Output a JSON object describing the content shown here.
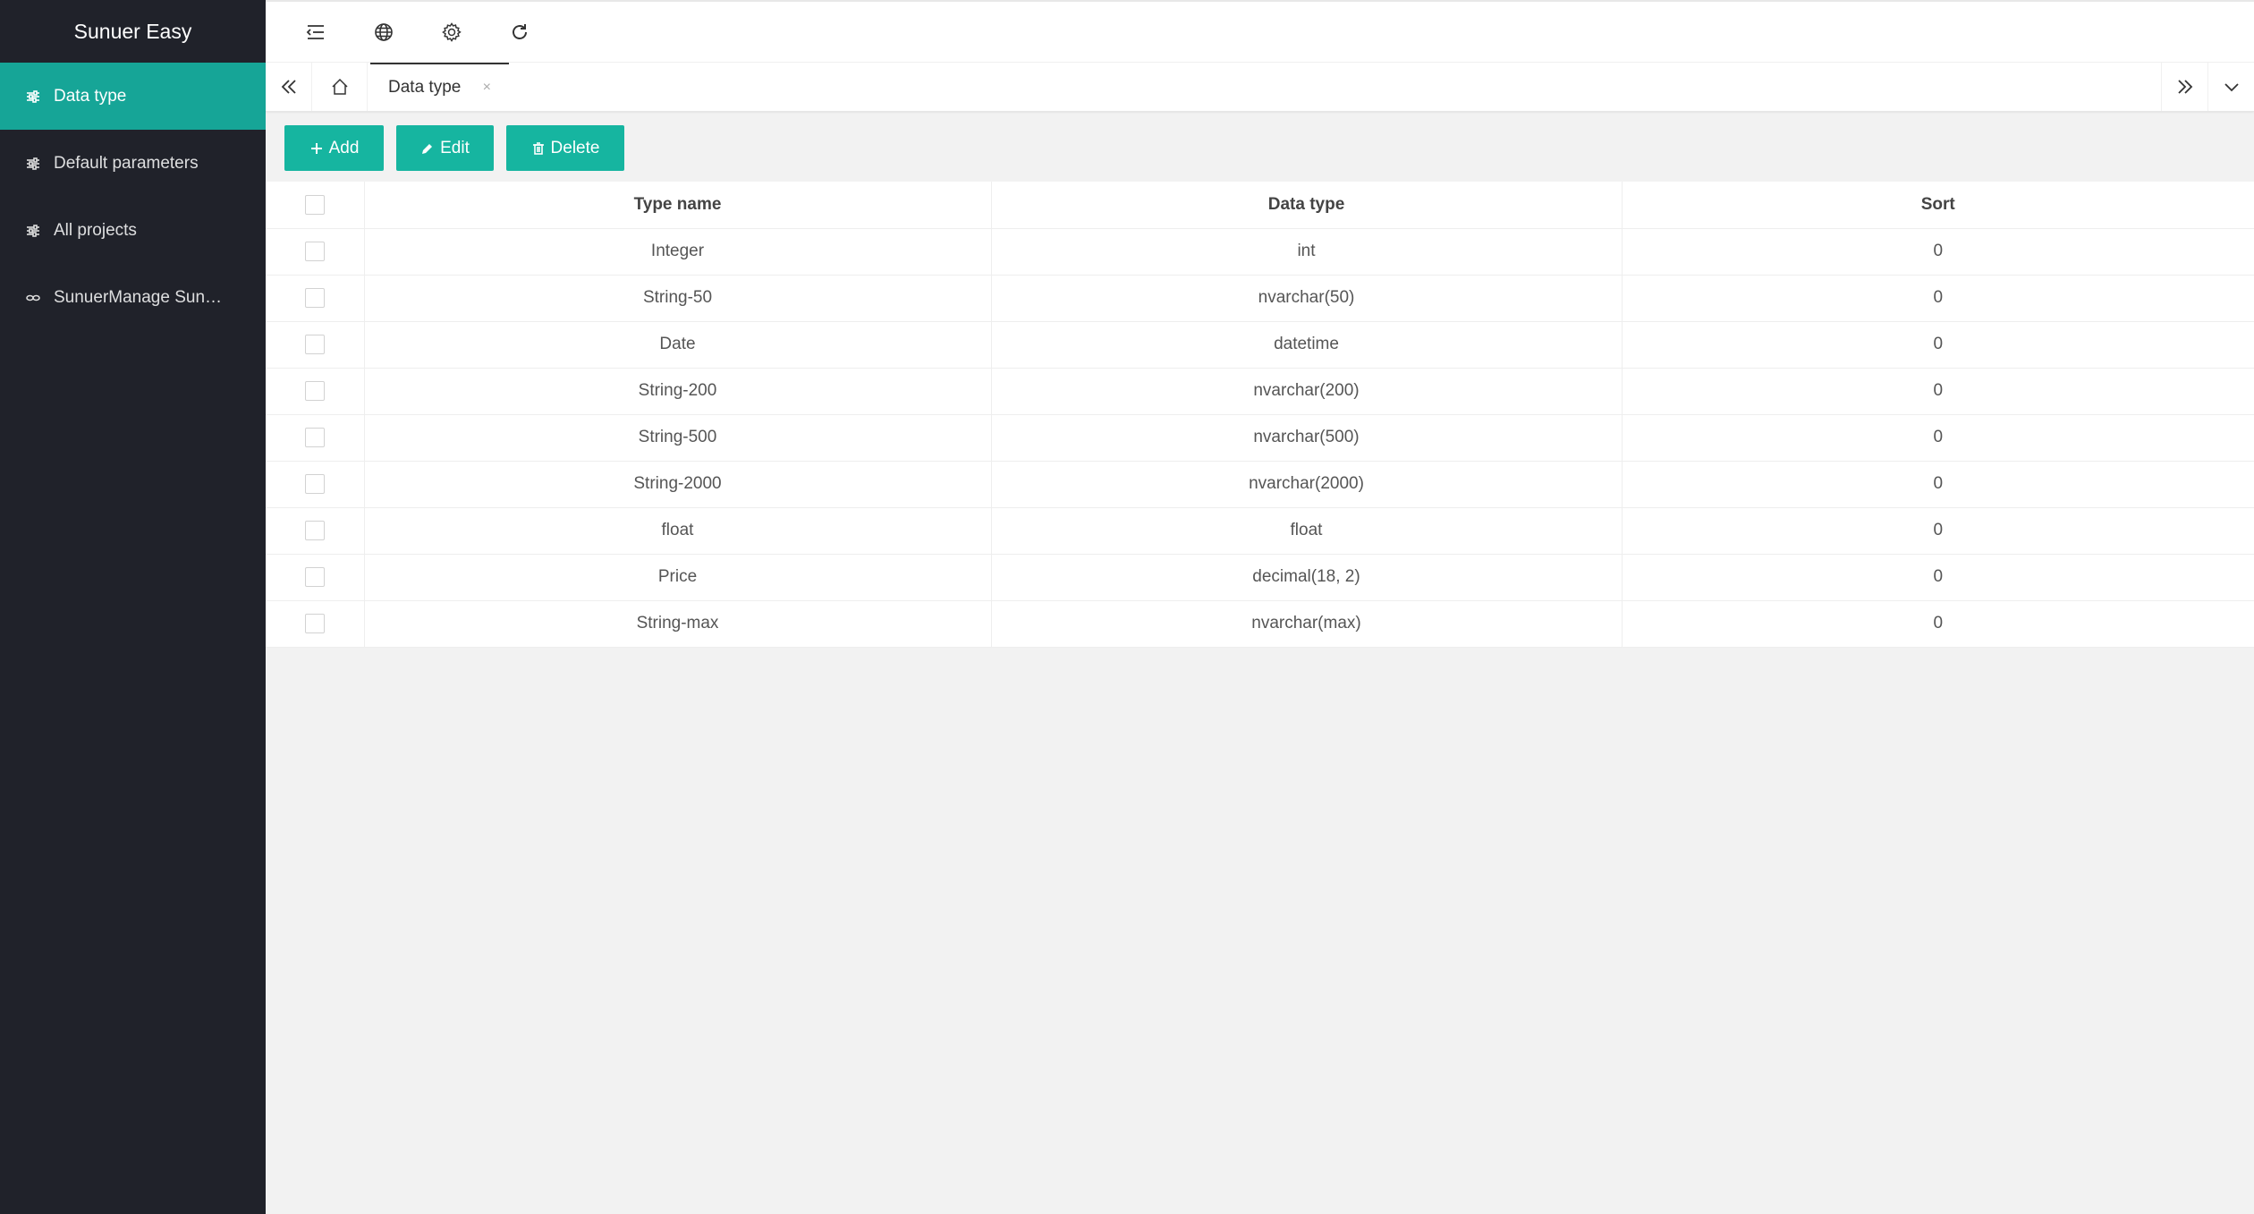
{
  "app": {
    "title": "Sunuer Easy"
  },
  "sidebar": {
    "items": [
      {
        "label": "Data type",
        "icon": "sliders-icon",
        "active": true
      },
      {
        "label": "Default parameters",
        "icon": "sliders-icon",
        "active": false
      },
      {
        "label": "All projects",
        "icon": "sliders-icon",
        "active": false
      },
      {
        "label": "SunuerManage Sun…",
        "icon": "link-icon",
        "active": false
      }
    ]
  },
  "header": {
    "icons": [
      "menu-collapse-icon",
      "globe-icon",
      "gear-icon",
      "refresh-icon"
    ]
  },
  "tabs": {
    "items": [
      {
        "label": "Data type",
        "close": "×"
      }
    ]
  },
  "toolbar": {
    "add_label": "Add",
    "edit_label": "Edit",
    "delete_label": "Delete"
  },
  "table": {
    "columns": [
      "Type name",
      "Data type",
      "Sort"
    ],
    "rows": [
      [
        "Integer",
        "int",
        "0"
      ],
      [
        "String-50",
        "nvarchar(50)",
        "0"
      ],
      [
        "Date",
        "datetime",
        "0"
      ],
      [
        "String-200",
        "nvarchar(200)",
        "0"
      ],
      [
        "String-500",
        "nvarchar(500)",
        "0"
      ],
      [
        "String-2000",
        "nvarchar(2000)",
        "0"
      ],
      [
        "float",
        "float",
        "0"
      ],
      [
        "Price",
        "decimal(18, 2)",
        "0"
      ],
      [
        "String-max",
        "nvarchar(max)",
        "0"
      ]
    ]
  },
  "colors": {
    "sidebar_bg": "#20222a",
    "accent": "#16a597",
    "button": "#16b5a0"
  }
}
